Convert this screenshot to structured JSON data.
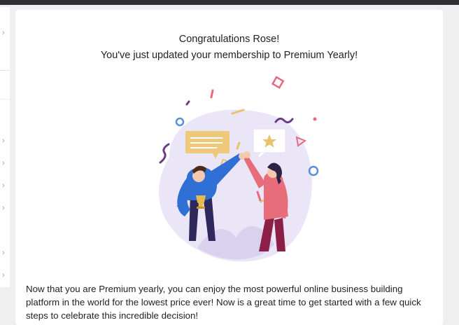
{
  "dialog": {
    "title_line1": "Congratulations Rose!",
    "title_line2": "You've just updated your membership to Premium Yearly!",
    "body": "Now that you are Premium yearly, you can enjoy the most powerful online business building platform in the world for the lowest price ever! Now is a great time to get started with a few quick steps to celebrate this incredible decision!"
  },
  "sidebar": {
    "chevron": "›"
  },
  "colors": {
    "accent_blue": "#2f6fd6",
    "blob": "#ebe6f7",
    "pink": "#e66a7b",
    "purple": "#6a3d86",
    "yellow": "#e8c26e"
  },
  "icons": [
    "chevron-right-icon",
    "trophy-icon",
    "star-icon"
  ]
}
